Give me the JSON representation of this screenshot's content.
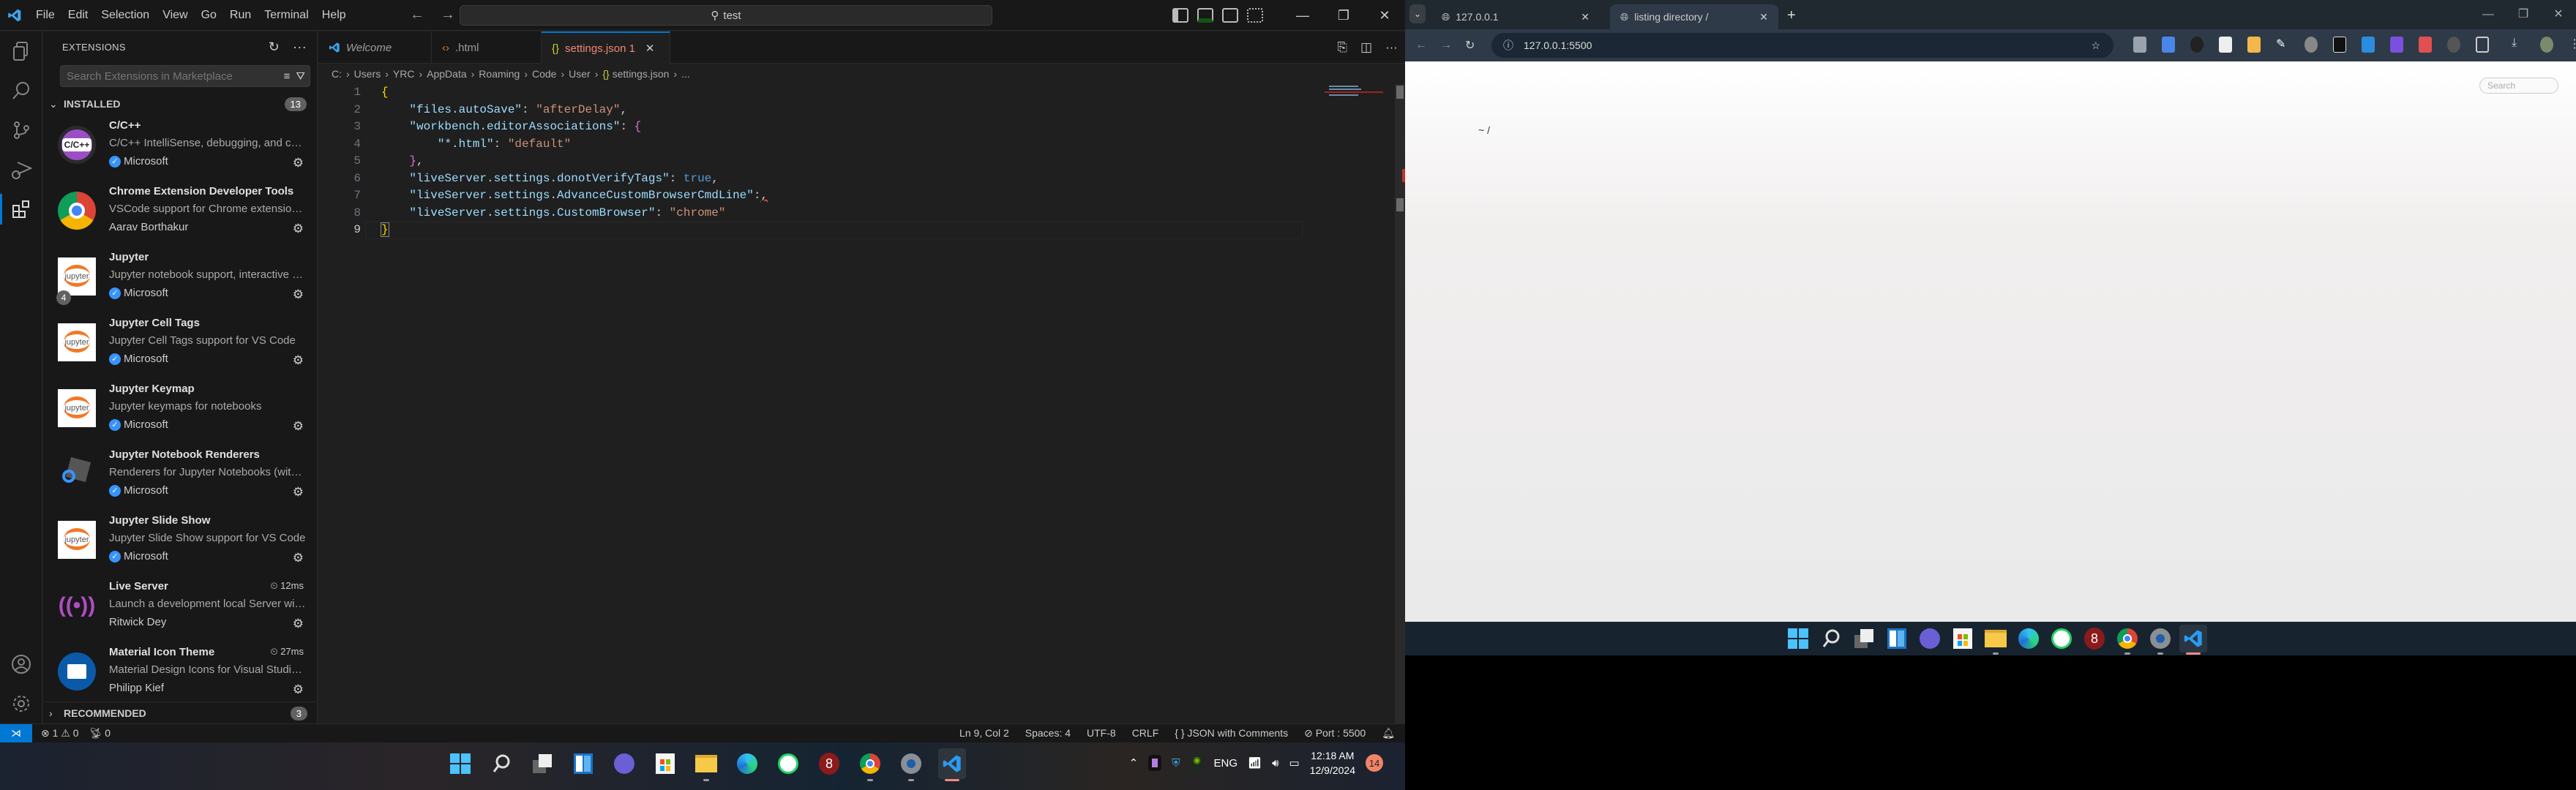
{
  "vscode": {
    "menu": [
      "File",
      "Edit",
      "Selection",
      "View",
      "Go",
      "Run",
      "Terminal",
      "Help"
    ],
    "command_center": "test",
    "sidebar": {
      "title": "EXTENSIONS",
      "search_placeholder": "Search Extensions in Marketplace",
      "installed_label": "INSTALLED",
      "installed_count": "13",
      "recommended_label": "RECOMMENDED",
      "recommended_count": "3",
      "extensions": [
        {
          "name": "C/C++",
          "description": "C/C++ IntelliSense, debugging, and code browsing.",
          "publisher": "Microsoft",
          "verified": true,
          "timing": ""
        },
        {
          "name": "Chrome Extension Developer Tools",
          "description": "VSCode support for Chrome extension development",
          "publisher": "Aarav Borthakur",
          "verified": false,
          "timing": ""
        },
        {
          "name": "Jupyter",
          "description": "Jupyter notebook support, interactive programming",
          "publisher": "Microsoft",
          "verified": true,
          "timing": "",
          "badge": "4"
        },
        {
          "name": "Jupyter Cell Tags",
          "description": "Jupyter Cell Tags support for VS Code",
          "publisher": "Microsoft",
          "verified": true,
          "timing": ""
        },
        {
          "name": "Jupyter Keymap",
          "description": "Jupyter keymaps for notebooks",
          "publisher": "Microsoft",
          "verified": true,
          "timing": ""
        },
        {
          "name": "Jupyter Notebook Renderers",
          "description": "Renderers for Jupyter Notebooks (with plotly, vega...)",
          "publisher": "Microsoft",
          "verified": true,
          "timing": ""
        },
        {
          "name": "Jupyter Slide Show",
          "description": "Jupyter Slide Show support for VS Code",
          "publisher": "Microsoft",
          "verified": true,
          "timing": ""
        },
        {
          "name": "Live Server",
          "description": "Launch a development local Server with live reload",
          "publisher": "Ritwick Dey",
          "verified": false,
          "timing": "12ms"
        },
        {
          "name": "Material Icon Theme",
          "description": "Material Design Icons for Visual Studio Code",
          "publisher": "Philipp Kief",
          "verified": false,
          "timing": "27ms"
        }
      ]
    },
    "tabs": [
      {
        "label": "Welcome",
        "icon": "vscode-icon"
      },
      {
        "label": ".html",
        "icon": "html-icon"
      },
      {
        "label": "settings.json 1",
        "icon": "json-icon",
        "active": true
      }
    ],
    "breadcrumb": [
      "C:",
      "Users",
      "YRC",
      "AppData",
      "Roaming",
      "Code",
      "User",
      "settings.json",
      "..."
    ],
    "code_lines": [
      {
        "n": "1"
      },
      {
        "n": "2",
        "key": "\"files.autoSave\"",
        "val": "\"afterDelay\""
      },
      {
        "n": "3",
        "key": "\"workbench.editorAssociations\""
      },
      {
        "n": "4",
        "key": "\"*.html\"",
        "val": "\"default\""
      },
      {
        "n": "5"
      },
      {
        "n": "6",
        "key": "\"liveServer.settings.donotVerifyTags\"",
        "val": "true"
      },
      {
        "n": "7",
        "key": "\"liveServer.settings.AdvanceCustomBrowserCmdLine\""
      },
      {
        "n": "8",
        "key": "\"liveServer.settings.CustomBrowser\"",
        "val": "\"chrome\""
      },
      {
        "n": "9"
      }
    ],
    "status": {
      "errors": "1",
      "warnings": "0",
      "ports": "0",
      "position": "Ln 9, Col 2",
      "spaces": "Spaces: 4",
      "encoding": "UTF-8",
      "eol": "CRLF",
      "language": "JSON with Comments",
      "port": "Port : 5500"
    },
    "tray": {
      "lang": "ENG",
      "time": "12:18 AM",
      "date": "12/9/2024",
      "notifications": "14"
    }
  },
  "browser": {
    "tabs": [
      {
        "label": "127.0.0.1",
        "active": false
      },
      {
        "label": "listing directory /",
        "active": true
      }
    ],
    "url": "127.0.0.1:5500",
    "page": {
      "heading": "~ /",
      "search_placeholder": "Search"
    }
  },
  "colors": {
    "accent": "#0078d4",
    "error_tab": "#f48771",
    "taskbar_active": "#f28b82"
  }
}
